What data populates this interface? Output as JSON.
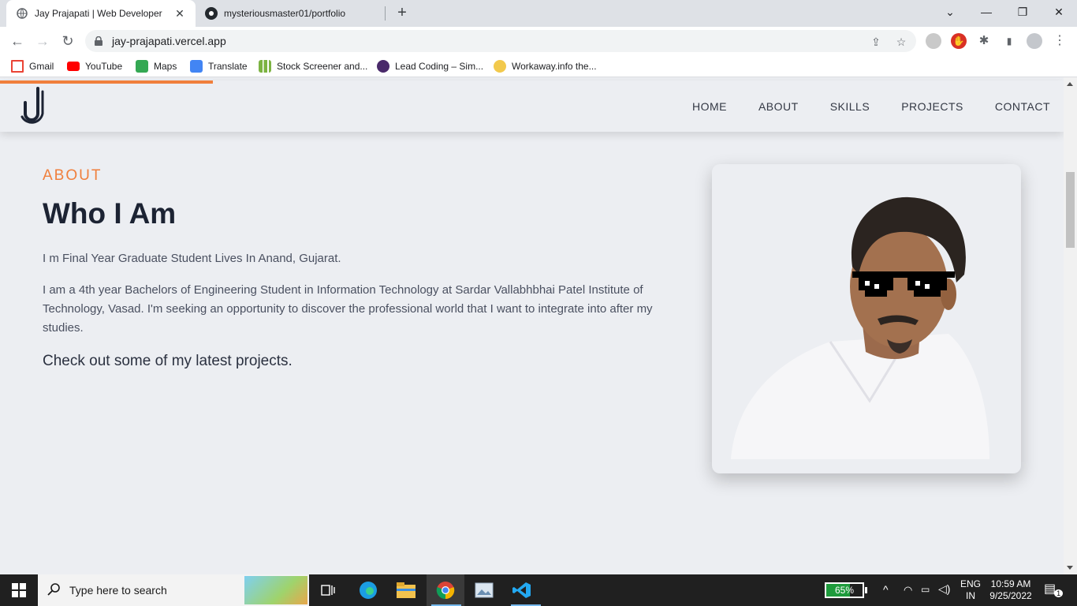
{
  "browser": {
    "tabs": [
      {
        "title": "Jay Prajapati | Web Developer",
        "icon": "globe-icon",
        "active": true
      },
      {
        "title": "mysteriousmaster01/portfolio",
        "icon": "github-icon",
        "active": false
      }
    ],
    "new_tab": "+",
    "window_controls": {
      "minimize": "—",
      "restore": "❐",
      "close": "✕",
      "tab_search": "⌄"
    },
    "url": "jay-prajapati.vercel.app",
    "bookmarks": [
      {
        "label": "Gmail",
        "icon": "gmail-icon",
        "color": "#ea4335"
      },
      {
        "label": "YouTube",
        "icon": "youtube-icon",
        "color": "#ff0000"
      },
      {
        "label": "Maps",
        "icon": "maps-icon",
        "color": "#34a853"
      },
      {
        "label": "Translate",
        "icon": "translate-icon",
        "color": "#4285f4"
      },
      {
        "label": "Stock Screener and...",
        "icon": "stock-icon",
        "color": "#7cb342"
      },
      {
        "label": "Lead Coding – Sim...",
        "icon": "leadcoding-icon",
        "color": "#4a2a6a"
      },
      {
        "label": "Workaway.info the...",
        "icon": "workaway-icon",
        "color": "#f2c94c"
      }
    ]
  },
  "site": {
    "nav": [
      "HOME",
      "ABOUT",
      "SKILLS",
      "PROJECTS",
      "CONTACT"
    ],
    "accent": "#f07f3c",
    "about": {
      "label": "ABOUT",
      "heading": "Who I Am",
      "intro": "I m Final Year Graduate Student Lives In Anand, Gujarat.",
      "body": "I am a 4th year Bachelors of Engineering Student in Information Technology at Sardar Vallabhbhai Patel Institute of Technology, Vasad. I'm seeking an opportunity to discover the professional world that I want to integrate into after my studies.",
      "cta": "Check out some of my latest projects."
    }
  },
  "taskbar": {
    "search_placeholder": "Type here to search",
    "battery": "65%",
    "battery_level": 0.65,
    "language": "ENG",
    "region": "IN",
    "time": "10:59 AM",
    "date": "9/25/2022",
    "notification_count": "1"
  }
}
